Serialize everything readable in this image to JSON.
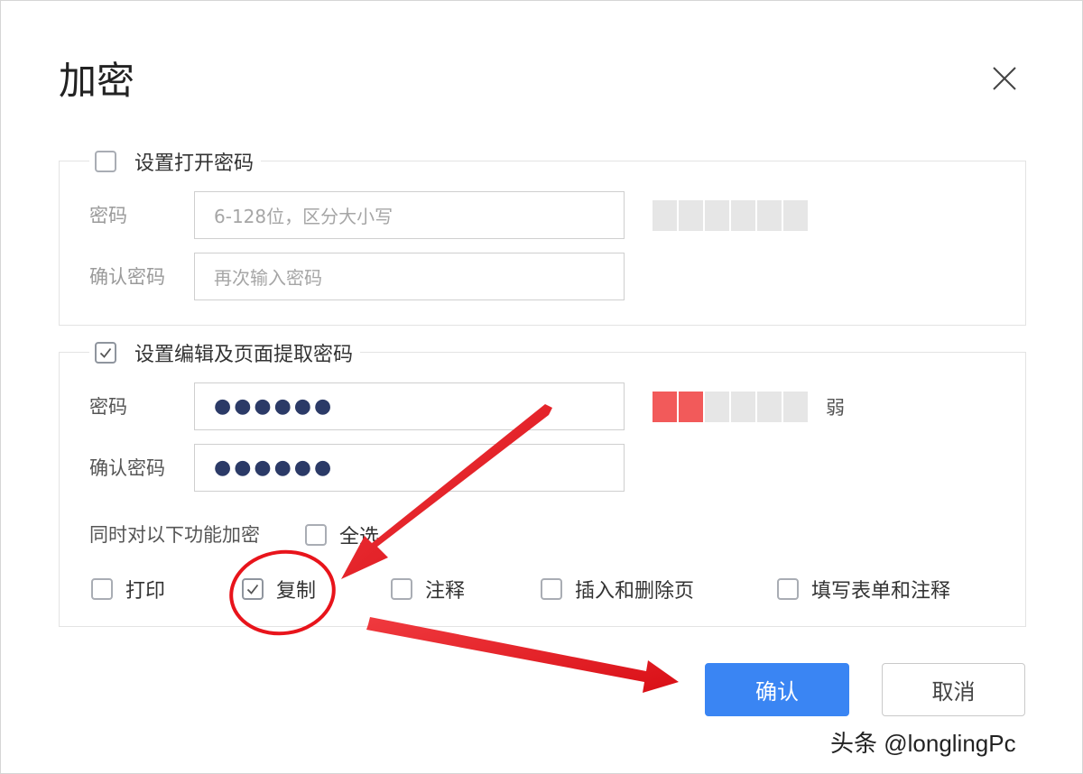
{
  "dialog": {
    "title": "加密"
  },
  "open_password": {
    "checkbox_label": "设置打开密码",
    "checked": false,
    "password_label": "密码",
    "password_placeholder": "6-128位，区分大小写",
    "confirm_label": "确认密码",
    "confirm_placeholder": "再次输入密码",
    "strength_level": 0,
    "strength_segments": 6
  },
  "edit_password": {
    "checkbox_label": "设置编辑及页面提取密码",
    "checked": true,
    "password_label": "密码",
    "password_value": "●●●●●●",
    "confirm_label": "确认密码",
    "confirm_value": "●●●●●●",
    "strength_level": 2,
    "strength_segments": 6,
    "strength_label": "弱"
  },
  "permissions": {
    "intro_label": "同时对以下功能加密",
    "select_all_label": "全选",
    "select_all_checked": false,
    "items": [
      {
        "label": "打印",
        "checked": false
      },
      {
        "label": "复制",
        "checked": true
      },
      {
        "label": "注释",
        "checked": false
      },
      {
        "label": "插入和删除页",
        "checked": false
      },
      {
        "label": "填写表单和注释",
        "checked": false
      }
    ]
  },
  "buttons": {
    "confirm_label": "确认",
    "cancel_label": "取消"
  },
  "watermark": {
    "text": "头条 @longlingPc"
  },
  "colors": {
    "primary": "#3a85f3",
    "strength_weak": "#f25a5a",
    "annotation_red": "#e8141b"
  }
}
